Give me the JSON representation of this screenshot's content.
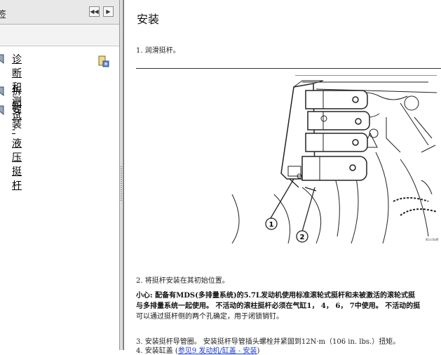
{
  "nav": {
    "title": "签",
    "items": [
      {
        "label": "诊断和测试 - 液压挺杆"
      },
      {
        "label": "拆卸"
      },
      {
        "label": "安装"
      }
    ],
    "item1_line1": "诊断和测试 - 液压挺",
    "item1_line2": "杆"
  },
  "doc": {
    "title": "安装",
    "step1": "1. 润滑挺杆。",
    "step2": "2. 将挺杆安装在其初始位置。",
    "caution_label": "小心: 配备有MDS(多排量系统)的5.7L发动机使用标准滚轮式挺杆和未被激活的滚轮式挺",
    "caution_line2": "与多排量系统一起使用。 不活动的滚柱挺杆必须在气缸1， 4， 6， 7中使用。 不活动的挺",
    "caution_line3": "可以通过挺杆侧的两个孔确定，用于闭锁销钉。",
    "step3": "3. 安装挺杆导管圈。 安装挺杆导管插头螺栓并紧固到12N·m（106 in. lbs.）扭矩。",
    "step4_prefix": "4. 安装缸盖 (",
    "step4_link": "参见9 发动机/缸盖 - 安装",
    "step4_suffix": ")",
    "fig_code": "81cc0a8f",
    "callout1": "1",
    "callout2": "2"
  }
}
